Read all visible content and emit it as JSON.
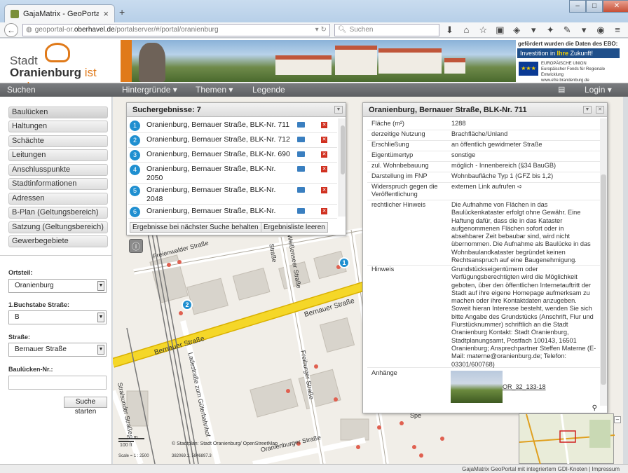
{
  "browser": {
    "tab_title": "GajaMatrix - GeoPortal ora...",
    "url_prefix": "geoportal-or.",
    "url_domain": "oberhavel.de",
    "url_path": "/portalserver/#/portal/oranienburg",
    "search_placeholder": "Suchen"
  },
  "banner": {
    "logo_line1": "Stadt",
    "logo_city": "Oranienburg",
    "logo_suffix": "ist anders.",
    "ebo_title": "gefördert wurden die Daten des EBO:",
    "ebo_slogan_pre": "Investition in ",
    "ebo_slogan_bold": "Ihre",
    "ebo_slogan_post": " Zukunft!",
    "eu_line1": "EUROPÄISCHE UNION",
    "eu_line2": "Europäischer Fonds für Regionale Entwicklung",
    "eu_line3": "www.efre.brandenburg.de"
  },
  "toolbar": {
    "search": "Suchen",
    "backgrounds": "Hintergründe ▾",
    "topics": "Themen ▾",
    "legend": "Legende",
    "login": "Login ▾"
  },
  "sidebar": {
    "items": [
      "Baulücken",
      "Haltungen",
      "Schächte",
      "Leitungen",
      "Anschlusspunkte",
      "Stadtinformationen",
      "Adressen",
      "B-Plan (Geltungsbereich)",
      "Satzung (Geltungsbereich)",
      "Gewerbegebiete"
    ],
    "ortsteil_label": "Ortsteil:",
    "ortsteil_value": "Oranienburg",
    "letter_label": "1.Buchstabe Straße:",
    "letter_value": "B",
    "street_label": "Straße:",
    "street_value": "Bernauer Straße",
    "nr_label": "Baulücken-Nr.:",
    "nr_value": "",
    "search_button": "Suche starten"
  },
  "results": {
    "title": "Suchergebnisse: 7",
    "items": [
      {
        "num": "1",
        "text": "Oranienburg, Bernauer Straße, BLK-Nr. 711"
      },
      {
        "num": "2",
        "text": "Oranienburg, Bernauer Straße, BLK-Nr. 712"
      },
      {
        "num": "3",
        "text": "Oranienburg, Bernauer Straße, BLK-Nr. 690"
      },
      {
        "num": "4",
        "text": "Oranienburg, Bernauer Straße, BLK-Nr. 2050"
      },
      {
        "num": "5",
        "text": "Oranienburg, Bernauer Straße, BLK-Nr. 2048"
      },
      {
        "num": "6",
        "text": "Oranienburg, Bernauer Straße, BLK-Nr."
      }
    ],
    "keep_button": "Ergebnisse bei nächster Suche behalten",
    "clear_button": "Ergebnisliste leeren"
  },
  "detail": {
    "title": "Oranienburg, Bernauer Straße, BLK-Nr. 711",
    "rows": [
      {
        "k": "Fläche (m²)",
        "v": "1288"
      },
      {
        "k": "derzeitige Nutzung",
        "v": "Brachfläche/Unland"
      },
      {
        "k": "Erschließung",
        "v": "an öffentlich gewidmeter Straße"
      },
      {
        "k": "Eigentümertyp",
        "v": "sonstige"
      },
      {
        "k": "zul. Wohnbebauung",
        "v": "möglich - Innenbereich (§34 BauGB)"
      },
      {
        "k": "Darstellung im FNP",
        "v": "Wohnbaufläche Typ 1 (GFZ bis 1,2)"
      },
      {
        "k": "Widerspruch gegen die Veröffentlichung",
        "v": "externen Link aufrufen ➪"
      },
      {
        "k": "rechtlicher Hinweis",
        "v": "Die Aufnahme von Flächen in das Baulückenkataster erfolgt ohne Gewähr. Eine Haftung dafür, dass die in das Kataster aufgenommenen Flächen sofort oder in absehbarer Zeit bebaubar sind, wird nicht übernommen. Die Aufnahme als Baulücke in das Wohnbaulandkataster begründet keinen Rechtsanspruch auf eine Baugenehmigung."
      },
      {
        "k": "Hinweis",
        "v": "Grundstückseigentümern oder Verfügungsberechtigten wird die Möglichkeit geboten, über den öffentlichen Internetauftritt der Stadt auf ihre eigene Homepage aufmerksam zu machen oder ihre Kontaktdaten anzugeben. Soweit hieran Interesse besteht, wenden Sie sich bitte Angabe des Grundstücks (Anschrift, Flur und Flurstücknummer) schriftlich an die Stadt Oranienburg Kontakt: Stadt Oranienburg, Stadtplanungsamt, Postfach 100143, 16501 Oranienburg; Ansprechpartner Steffen Materne (E-Mail: materne@oranienburg.de; Telefon: 03301/600768)"
      },
      {
        "k": "Anhänge",
        "v": ""
      }
    ],
    "attachment_label": "OR_32_133-18"
  },
  "map": {
    "streets": [
      "Bernauer Straße",
      "Bernauer Straße",
      "Freienwalder Straße",
      "Weißenseer Straße",
      "Straße",
      "Ladestraße zum Güterbahnhof",
      "Freiburger Straße",
      "Stralsunder Straße",
      "Oranienburger Straße",
      "Spe"
    ],
    "scale_m": "50 m",
    "scale_ft": "100 ft",
    "scale_text": "Scale = 1 : 2500",
    "coords": "382069.3, 5846897.3",
    "copyright": "© Stadtplan: Stadt Oranienburg/ OpenStreetMap"
  },
  "status": {
    "text": "GajaMatrix GeoPortal mit integriertem GDI-Knoten  |  Impressum"
  }
}
